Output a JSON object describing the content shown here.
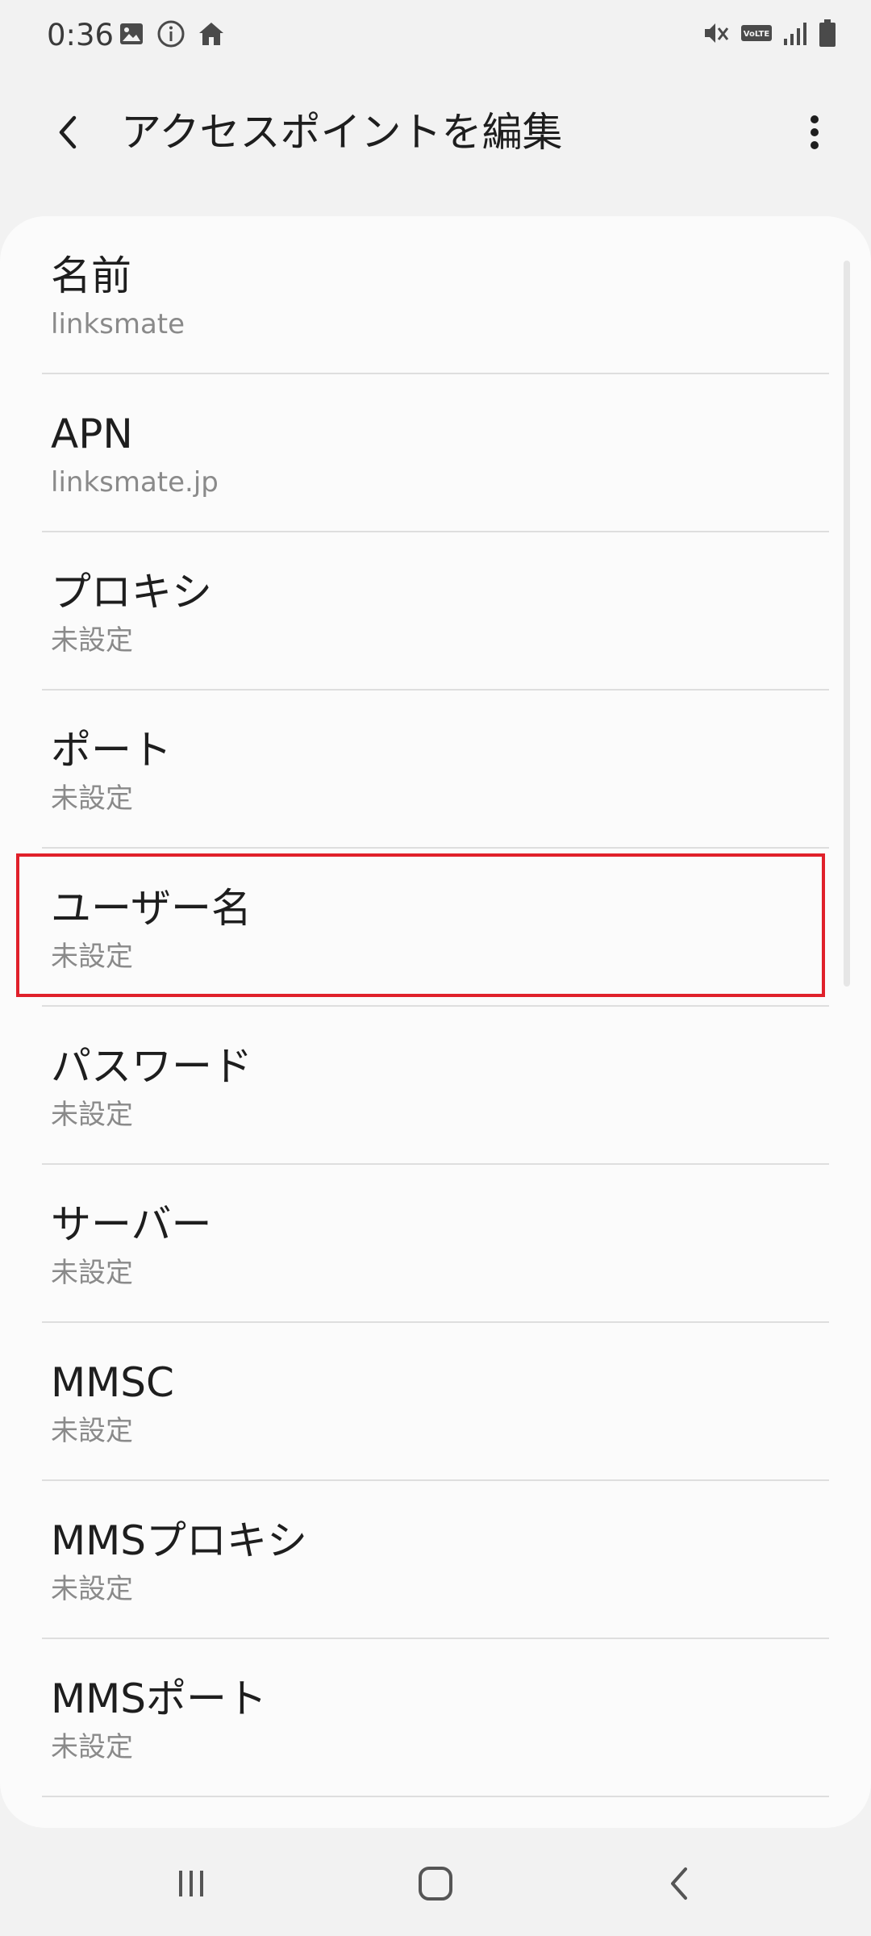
{
  "status_bar": {
    "time": "0:36",
    "left_icons": [
      "image-icon",
      "info-icon",
      "home-icon"
    ],
    "right_icons": [
      "vibrate-mute-icon",
      "volte-icon",
      "signal-icon",
      "battery-icon"
    ],
    "volte_label": "VoLTE"
  },
  "app_bar": {
    "title": "アクセスポイントを編集",
    "back_icon": "chevron-left-icon",
    "more_icon": "more-vert-icon"
  },
  "list": {
    "items": [
      {
        "title": "名前",
        "value": "linksmate"
      },
      {
        "title": "APN",
        "value": "linksmate.jp"
      },
      {
        "title": "プロキシ",
        "value": "未設定"
      },
      {
        "title": "ポート",
        "value": "未設定"
      },
      {
        "title": "ユーザー名",
        "value": "未設定"
      },
      {
        "title": "パスワード",
        "value": "未設定"
      },
      {
        "title": "サーバー",
        "value": "未設定"
      },
      {
        "title": "MMSC",
        "value": "未設定"
      },
      {
        "title": "MMSプロキシ",
        "value": "未設定"
      },
      {
        "title": "MMSポート",
        "value": "未設定"
      }
    ],
    "highlighted_item": "ユーザー名",
    "highlight_color": "#e0202a"
  },
  "nav_bar": {
    "buttons": [
      "recents-icon",
      "home-button-icon",
      "back-icon"
    ]
  },
  "colors": {
    "background": "#f2f2f2",
    "card": "#fbfbfb",
    "primary_text": "#1e1e1e",
    "secondary_text": "#8a8a8a"
  }
}
